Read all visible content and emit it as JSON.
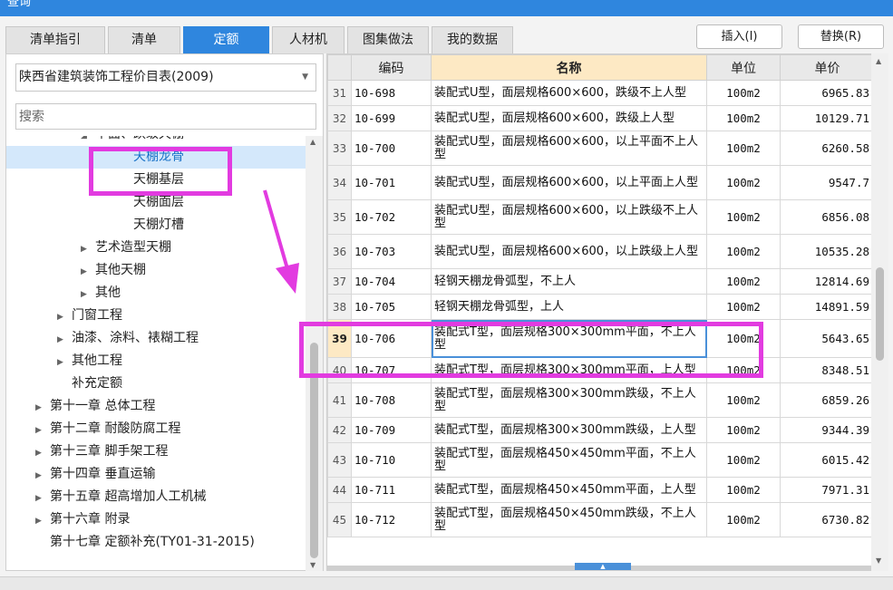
{
  "window": {
    "title": "查询"
  },
  "tabs": [
    {
      "label": "清单指引",
      "active": false
    },
    {
      "label": "清单",
      "active": false
    },
    {
      "label": "定额",
      "active": true
    },
    {
      "label": "人材机",
      "active": false
    },
    {
      "label": "图集做法",
      "active": false
    },
    {
      "label": "我的数据",
      "active": false
    }
  ],
  "toolbar": {
    "insert_label": "插入(I)",
    "replace_label": "替换(R)"
  },
  "left_panel": {
    "library_select": "陕西省建筑装饰工程价目表(2009)",
    "search_placeholder": "搜索",
    "tree": [
      {
        "label": "平面、跌级天棚",
        "level": 3,
        "caret": "open",
        "selected": false
      },
      {
        "label": "天棚龙骨",
        "level": 4,
        "caret": "",
        "selected": true
      },
      {
        "label": "天棚基层",
        "level": 4,
        "caret": "",
        "selected": false
      },
      {
        "label": "天棚面层",
        "level": 4,
        "caret": "",
        "selected": false
      },
      {
        "label": "天棚灯槽",
        "level": 4,
        "caret": "",
        "selected": false
      },
      {
        "label": "艺术造型天棚",
        "level": 3,
        "caret": "closed",
        "selected": false
      },
      {
        "label": "其他天棚",
        "level": 3,
        "caret": "closed",
        "selected": false
      },
      {
        "label": "其他",
        "level": 3,
        "caret": "closed",
        "selected": false
      },
      {
        "label": "门窗工程",
        "level": 2,
        "caret": "closed",
        "selected": false
      },
      {
        "label": "油漆、涂料、裱糊工程",
        "level": 2,
        "caret": "closed",
        "selected": false
      },
      {
        "label": "其他工程",
        "level": 2,
        "caret": "closed",
        "selected": false
      },
      {
        "label": "补充定额",
        "level": 2,
        "caret": "",
        "selected": false
      },
      {
        "label": "第十一章 总体工程",
        "level": 1,
        "caret": "closed",
        "selected": false
      },
      {
        "label": "第十二章 耐酸防腐工程",
        "level": 1,
        "caret": "closed",
        "selected": false
      },
      {
        "label": "第十三章 脚手架工程",
        "level": 1,
        "caret": "closed",
        "selected": false
      },
      {
        "label": "第十四章 垂直运输",
        "level": 1,
        "caret": "closed",
        "selected": false
      },
      {
        "label": "第十五章 超高增加人工机械",
        "level": 1,
        "caret": "closed",
        "selected": false
      },
      {
        "label": "第十六章 附录",
        "level": 1,
        "caret": "closed",
        "selected": false
      },
      {
        "label": "第十七章 定额补充(TY01-31-2015)",
        "level": 1,
        "caret": "",
        "selected": false
      }
    ]
  },
  "grid": {
    "columns": [
      "编码",
      "名称",
      "单位",
      "单价"
    ],
    "rows": [
      {
        "num": "31",
        "code": "10-698",
        "name": "装配式U型，面层规格600×600，跌级不上人型",
        "unit": "100m2",
        "price": "6965.83",
        "current": false
      },
      {
        "num": "32",
        "code": "10-699",
        "name": "装配式U型，面层规格600×600，跌级上人型",
        "unit": "100m2",
        "price": "10129.71",
        "current": false
      },
      {
        "num": "33",
        "code": "10-700",
        "name": "装配式U型，面层规格600×600，以上平面不上人型",
        "unit": "100m2",
        "price": "6260.58",
        "current": false
      },
      {
        "num": "34",
        "code": "10-701",
        "name": "装配式U型，面层规格600×600，以上平面上人型",
        "unit": "100m2",
        "price": "9547.7",
        "current": false
      },
      {
        "num": "35",
        "code": "10-702",
        "name": "装配式U型，面层规格600×600，以上跌级不上人型",
        "unit": "100m2",
        "price": "6856.08",
        "current": false
      },
      {
        "num": "36",
        "code": "10-703",
        "name": "装配式U型，面层规格600×600，以上跌级上人型",
        "unit": "100m2",
        "price": "10535.28",
        "current": false
      },
      {
        "num": "37",
        "code": "10-704",
        "name": "轻钢天棚龙骨弧型，不上人",
        "unit": "100m2",
        "price": "12814.69",
        "current": false
      },
      {
        "num": "38",
        "code": "10-705",
        "name": "轻钢天棚龙骨弧型，上人",
        "unit": "100m2",
        "price": "14891.59",
        "current": false
      },
      {
        "num": "39",
        "code": "10-706",
        "name": "装配式T型，面层规格300×300mm平面，不上人型",
        "unit": "100m2",
        "price": "5643.65",
        "current": true
      },
      {
        "num": "40",
        "code": "10-707",
        "name": "装配式T型，面层规格300×300mm平面，上人型",
        "unit": "100m2",
        "price": "8348.51",
        "current": false
      },
      {
        "num": "41",
        "code": "10-708",
        "name": "装配式T型，面层规格300×300mm跌级，不上人型",
        "unit": "100m2",
        "price": "6859.26",
        "current": false
      },
      {
        "num": "42",
        "code": "10-709",
        "name": "装配式T型，面层规格300×300mm跌级，上人型",
        "unit": "100m2",
        "price": "9344.39",
        "current": false
      },
      {
        "num": "43",
        "code": "10-710",
        "name": "装配式T型，面层规格450×450mm平面，不上人型",
        "unit": "100m2",
        "price": "6015.42",
        "current": false
      },
      {
        "num": "44",
        "code": "10-711",
        "name": "装配式T型，面层规格450×450mm平面，上人型",
        "unit": "100m2",
        "price": "7971.31",
        "current": false
      },
      {
        "num": "45",
        "code": "10-712",
        "name": "装配式T型，面层规格450×450mm跌级，不上人型",
        "unit": "100m2",
        "price": "6730.82",
        "current": false
      }
    ]
  },
  "colors": {
    "accent": "#2f86de",
    "annotation": "#e23be0",
    "header_highlight": "#fde9c4"
  }
}
